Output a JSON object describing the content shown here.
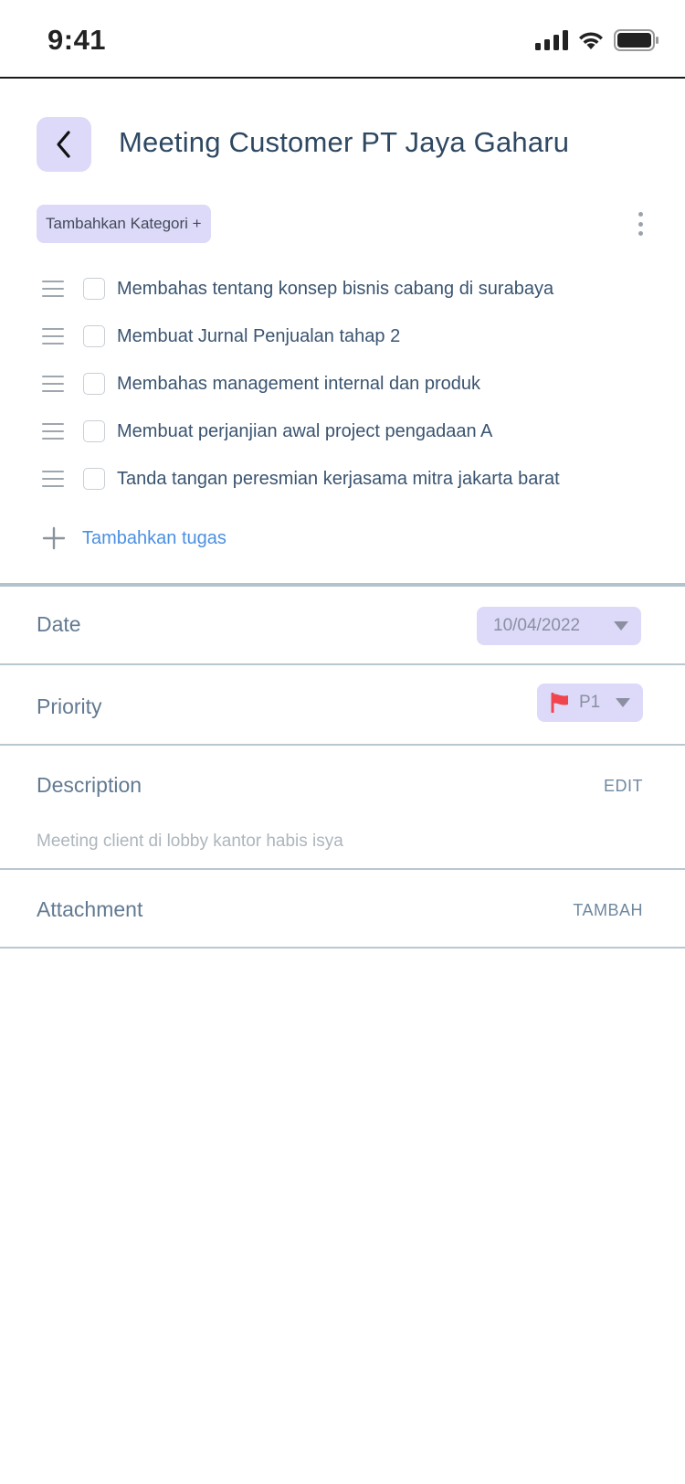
{
  "status_bar": {
    "time": "9:41"
  },
  "header": {
    "title": "Meeting Customer PT Jaya Gaharu"
  },
  "category": {
    "label": "Tambahkan Kategori +"
  },
  "tasks": [
    {
      "label": "Membahas tentang konsep bisnis cabang di surabaya",
      "checked": false
    },
    {
      "label": "Membuat Jurnal Penjualan tahap 2",
      "checked": false
    },
    {
      "label": "Membahas management internal dan produk",
      "checked": false
    },
    {
      "label": "Membuat perjanjian awal project pengadaan A",
      "checked": false
    },
    {
      "label": "Tanda tangan peresmian kerjasama mitra jakarta barat",
      "checked": false
    }
  ],
  "add_task": {
    "label": "Tambahkan tugas"
  },
  "date": {
    "label": "Date",
    "value": "10/04/2022"
  },
  "priority": {
    "label": "Priority",
    "value": "P1",
    "flag_color": "#f0454f"
  },
  "description": {
    "label": "Description",
    "action": "EDIT",
    "text": "Meeting client di lobby kantor habis isya"
  },
  "attachment": {
    "label": "Attachment",
    "action": "TAMBAH"
  },
  "colors": {
    "accent_bg": "#dcdaf8",
    "link": "#4a90e2",
    "divider": "#b9c7d1"
  }
}
